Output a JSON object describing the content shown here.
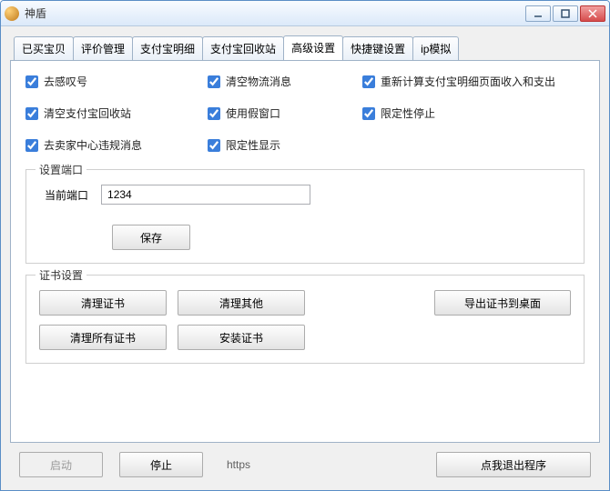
{
  "window": {
    "title": "神盾"
  },
  "tabs": [
    "已买宝贝",
    "评价管理",
    "支付宝明细",
    "支付宝回收站",
    "高级设置",
    "快捷键设置",
    "ip模拟"
  ],
  "activeTabIndex": 4,
  "checks": {
    "r1c1": "去感叹号",
    "r1c2": "清空物流消息",
    "r1c3": "重新计算支付宝明细页面收入和支出",
    "r2c1": "清空支付宝回收站",
    "r2c2": "使用假窗口",
    "r2c3": "限定性停止",
    "r3c1": "去卖家中心违规消息",
    "r3c2": "限定性显示"
  },
  "portSection": {
    "legend": "设置端口",
    "label": "当前端口",
    "value": "1234",
    "save": "保存"
  },
  "certSection": {
    "legend": "证书设置",
    "clearCert": "清理证书",
    "clearOther": "清理其他",
    "exportCert": "导出证书到桌面",
    "clearAll": "清理所有证书",
    "install": "安装证书"
  },
  "bottom": {
    "start": "启动",
    "stop": "停止",
    "https": "https",
    "exit": "点我退出程序"
  }
}
